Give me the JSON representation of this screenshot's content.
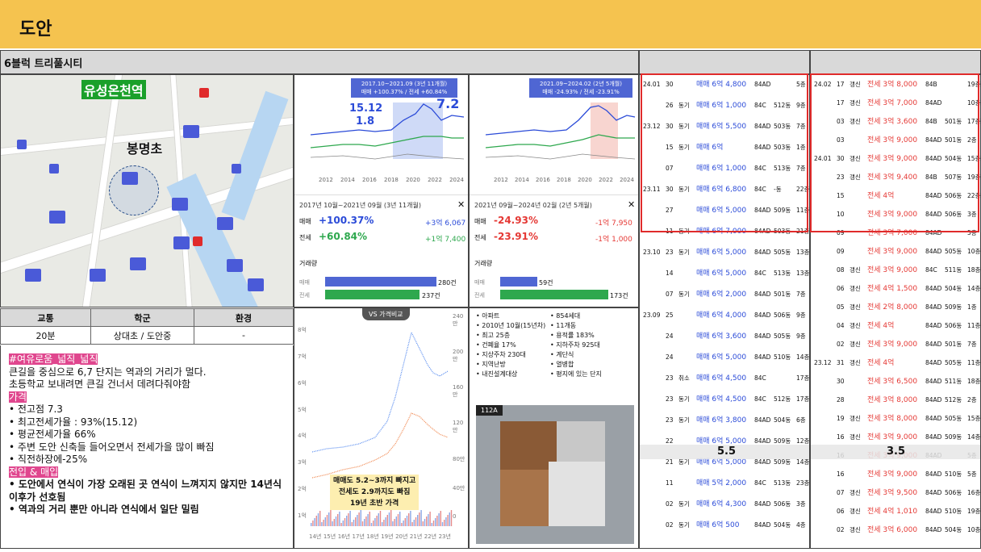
{
  "header": {
    "title": "도안"
  },
  "section": {
    "title": "6블럭 트리풀시티"
  },
  "map": {
    "station_label": "유성온천역",
    "school_label": "봉명초"
  },
  "chart1": {
    "tooltip_line1": "2017.10~2021.09 (3년 11개월)",
    "tooltip_line2": "매매 +100.37% / 전세 +60.84%",
    "overlay_a": "15.12",
    "overlay_b": "1.8",
    "overlay_c": "7.2",
    "period": "2017년 10월~2021년 09월 (3년 11개월)",
    "sale_label": "매매",
    "sale_pct": "+100.37%",
    "sale_amt": "+3억 6,067",
    "jeonse_label": "전세",
    "jeonse_pct": "+60.84%",
    "jeonse_amt": "+1억 7,400",
    "volume_title": "거래량",
    "vol_sale": "280건",
    "vol_jeonse": "237건",
    "years": [
      "2012",
      "2014",
      "2016",
      "2018",
      "2020",
      "2022",
      "2024"
    ]
  },
  "chart2": {
    "tooltip_line1": "2021.09~2024.02 (2년 5개월)",
    "tooltip_line2": "매매 -24.93% / 전세 -23.91%",
    "period": "2021년 09월~2024년 02월 (2년 5개월)",
    "sale_label": "매매",
    "sale_pct": "-24.93%",
    "sale_amt": "-1억 7,950",
    "jeonse_label": "전세",
    "jeonse_pct": "-23.91%",
    "jeonse_amt": "-1억 1,000",
    "volume_title": "거래량",
    "vol_sale": "59건",
    "vol_jeonse": "173건",
    "years": [
      "2012",
      "2014",
      "2016",
      "2018",
      "2020",
      "2022",
      "2024"
    ]
  },
  "info_table": {
    "headers": [
      "교통",
      "학군",
      "환경"
    ],
    "values": [
      "20분",
      "상대초 / 도안중",
      "-"
    ]
  },
  "notes": {
    "tag1": "#여유로움_넓직_넓직",
    "line1": "큰길을 중심으로 6,7 단지는 역과의 거리가 멀다.",
    "line2": "초등학교 보내려면 큰길 건너서 데려다줘야함",
    "tag2": "가격",
    "bullets1": [
      "전고점 7.3",
      "최고전세가율 : 93%(15.12)",
      "평균전세가율 66%",
      "주변 도안 신축들 들어오면서 전세가을 많이 빠짐",
      "직전하장에-25%"
    ],
    "tag3": "전입 & 매입",
    "bullets2": [
      "도안에서 연식이 가장 오래된 곳 연식이 느껴지지 않지만 14년식 이후가 선호됨",
      "역과의 거리 뿐만 아니라 연식에서 일단 밀림"
    ]
  },
  "price_chart": {
    "tag": "VS 가격비교",
    "y_labels": [
      "8억",
      "7억",
      "6억",
      "5억",
      "4억",
      "3억",
      "2억",
      "1억"
    ],
    "y_right": [
      "240만",
      "200만",
      "160만",
      "120만",
      "80만",
      "40만",
      "0"
    ],
    "x_labels": [
      "14년",
      "15년",
      "16년",
      "17년",
      "18년",
      "19년",
      "20년",
      "21년",
      "22년",
      "23년"
    ],
    "caption1": "매매도 5.2~3까지 빠지고",
    "caption2": "전세도 2.9까지도 빠짐",
    "caption3": "19년 초반 가격"
  },
  "complex_info": {
    "left": [
      "아파트",
      "2010년 10월(15년차)",
      "최고 25층",
      "건폐율 17%",
      "지상주차 230대",
      "지역난방",
      "내진설계대상"
    ],
    "right": [
      "854세대",
      "11개동",
      "용적률 183%",
      "지하주차 925대",
      "계단식",
      "열병합",
      "평지에 있는 단지"
    ],
    "plan_label": "112A"
  },
  "sale_list": {
    "overlay": "5.5",
    "rows": [
      [
        "24.01",
        "30",
        "",
        "매매 6억 4,800",
        "84AD",
        "",
        "5층"
      ],
      [
        "",
        "26",
        "동기",
        "매매 6억 1,000",
        "84C",
        "512동",
        "9층"
      ],
      [
        "23.12",
        "30",
        "동기",
        "매매 6억 5,500",
        "84AD",
        "503동",
        "7층"
      ],
      [
        "",
        "15",
        "동기",
        "매매 6억",
        "84AD",
        "503동",
        "1층"
      ],
      [
        "",
        "07",
        "",
        "매매 6억 1,000",
        "84C",
        "513동",
        "7층"
      ],
      [
        "23.11",
        "30",
        "동기",
        "매매 6억 6,800",
        "84C",
        "-동",
        "22층"
      ],
      [
        "",
        "27",
        "",
        "매매 6억 5,000",
        "84AD",
        "509동",
        "11층"
      ],
      [
        "",
        "11",
        "동기",
        "매매 6억 7,000",
        "84AD",
        "503동",
        "21층"
      ],
      [
        "23.10",
        "23",
        "동기",
        "매매 6억 5,000",
        "84AD",
        "505동",
        "13층"
      ],
      [
        "",
        "14",
        "",
        "매매 6억 5,000",
        "84C",
        "513동",
        "13층"
      ],
      [
        "",
        "07",
        "동기",
        "매매 6억 2,000",
        "84AD",
        "501동",
        "7층"
      ],
      [
        "23.09",
        "25",
        "",
        "매매 6억 4,000",
        "84AD",
        "506동",
        "9층"
      ],
      [
        "",
        "24",
        "",
        "매매 6억 3,600",
        "84AD",
        "505동",
        "9층"
      ],
      [
        "",
        "24",
        "",
        "매매 6억 5,000",
        "84AD",
        "510동",
        "14층"
      ],
      [
        "",
        "23",
        "취소",
        "매매 6억 4,500",
        "84C",
        "",
        "17층"
      ],
      [
        "",
        "23",
        "동기",
        "매매 6억 4,500",
        "84C",
        "512동",
        "17층"
      ],
      [
        "",
        "23",
        "동기",
        "매매 6억 3,800",
        "84AD",
        "504동",
        "6층"
      ],
      [
        "",
        "22",
        "",
        "매매 6억 5,000",
        "84AD",
        "509동",
        "12층"
      ],
      [
        "",
        "21",
        "동기",
        "매매 6억 5,000",
        "84AD",
        "509동",
        "14층"
      ],
      [
        "",
        "11",
        "",
        "매매 5억 2,000",
        "84C",
        "513동",
        "23층"
      ],
      [
        "",
        "02",
        "동기",
        "매매 6억 4,300",
        "84AD",
        "506동",
        "3층"
      ],
      [
        "",
        "02",
        "동기",
        "매매 6억 500",
        "84AD",
        "504동",
        "4층"
      ]
    ]
  },
  "jeonse_list": {
    "overlay": "3.5",
    "rows": [
      [
        "24.02",
        "17",
        "갱신",
        "전세 3억 8,000",
        "84B",
        "",
        "19층"
      ],
      [
        "",
        "17",
        "갱신",
        "전세 3억 7,000",
        "84AD",
        "",
        "10층"
      ],
      [
        "",
        "03",
        "갱신",
        "전세 3억 3,600",
        "84B",
        "501동",
        "17층"
      ],
      [
        "",
        "03",
        "",
        "전세 3억 9,000",
        "84AD",
        "501동",
        "2층"
      ],
      [
        "24.01",
        "30",
        "갱신",
        "전세 3억 9,000",
        "84AD",
        "504동",
        "15층"
      ],
      [
        "",
        "23",
        "갱신",
        "전세 3억 9,400",
        "84B",
        "507동",
        "19층"
      ],
      [
        "",
        "15",
        "",
        "전세 4억",
        "84AD",
        "506동",
        "22층"
      ],
      [
        "",
        "10",
        "",
        "전세 3억 9,000",
        "84AD",
        "506동",
        "3층"
      ],
      [
        "",
        "09",
        "",
        "전세 3억 7,000",
        "84AD",
        "",
        "5층"
      ],
      [
        "",
        "09",
        "",
        "전세 3억 9,000",
        "84AD",
        "505동",
        "10층"
      ],
      [
        "",
        "08",
        "갱신",
        "전세 3억 9,000",
        "84C",
        "511동",
        "18층"
      ],
      [
        "",
        "06",
        "갱신",
        "전세 4억 1,500",
        "84AD",
        "504동",
        "14층"
      ],
      [
        "",
        "05",
        "갱신",
        "전세 2억 8,000",
        "84AD",
        "509동",
        "1층"
      ],
      [
        "",
        "04",
        "갱신",
        "전세 4억",
        "84AD",
        "506동",
        "11층"
      ],
      [
        "",
        "02",
        "갱신",
        "전세 3억 9,000",
        "84AD",
        "501동",
        "7층"
      ],
      [
        "23.12",
        "31",
        "갱신",
        "전세 4억",
        "84AD",
        "505동",
        "11층"
      ],
      [
        "",
        "30",
        "",
        "전세 3억 6,500",
        "84AD",
        "511동",
        "18층"
      ],
      [
        "",
        "28",
        "",
        "전세 3억 8,000",
        "84AD",
        "512동",
        "2층"
      ],
      [
        "",
        "19",
        "갱신",
        "전세 3억 8,000",
        "84AD",
        "505동",
        "15층"
      ],
      [
        "",
        "16",
        "갱신",
        "전세 3억 9,000",
        "84AD",
        "509동",
        "14층"
      ],
      [
        "",
        "16",
        "",
        "전세 3억 9,000",
        "84AD",
        "",
        "5층"
      ],
      [
        "",
        "16",
        "",
        "전세 3억 9,000",
        "84AD",
        "510동",
        "5층"
      ],
      [
        "",
        "07",
        "갱신",
        "전세 3억 9,500",
        "84AD",
        "506동",
        "16층"
      ],
      [
        "",
        "06",
        "갱신",
        "전세 4억 1,010",
        "84AD",
        "510동",
        "19층"
      ],
      [
        "",
        "02",
        "갱신",
        "전세 3억 6,000",
        "84AD",
        "504동",
        "10층"
      ]
    ]
  },
  "colors": {
    "header_bg": "#f5c34f",
    "sale_blue": "#4a7ad8",
    "jeonse_green": "#2ea84e",
    "highlight": "#e0468e",
    "red_box": "#e02b2b"
  }
}
